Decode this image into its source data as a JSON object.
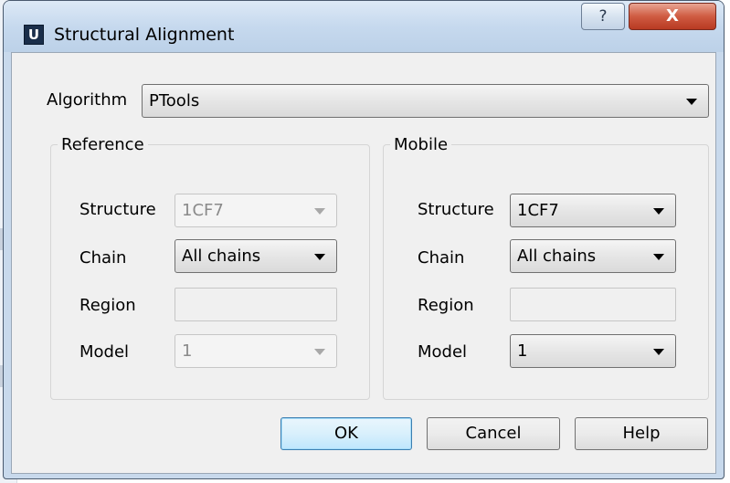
{
  "window": {
    "title": "Structural Alignment",
    "app_icon": "U",
    "help_icon": "?",
    "close_icon": "X"
  },
  "algorithm": {
    "label": "Algorithm",
    "value": "PTools"
  },
  "reference": {
    "title": "Reference",
    "structure": {
      "label": "Structure",
      "value": "1CF7"
    },
    "chain": {
      "label": "Chain",
      "value": "All chains"
    },
    "region": {
      "label": "Region",
      "value": ""
    },
    "model": {
      "label": "Model",
      "value": "1"
    }
  },
  "mobile": {
    "title": "Mobile",
    "structure": {
      "label": "Structure",
      "value": "1CF7"
    },
    "chain": {
      "label": "Chain",
      "value": "All chains"
    },
    "region": {
      "label": "Region",
      "value": ""
    },
    "model": {
      "label": "Model",
      "value": "1"
    }
  },
  "buttons": {
    "ok": "OK",
    "cancel": "Cancel",
    "help": "Help"
  },
  "colors": {
    "titlebar": "#c6d9ee",
    "close": "#cf5b42",
    "client": "#f0f0f0",
    "default_button": "#d9f0fc"
  }
}
